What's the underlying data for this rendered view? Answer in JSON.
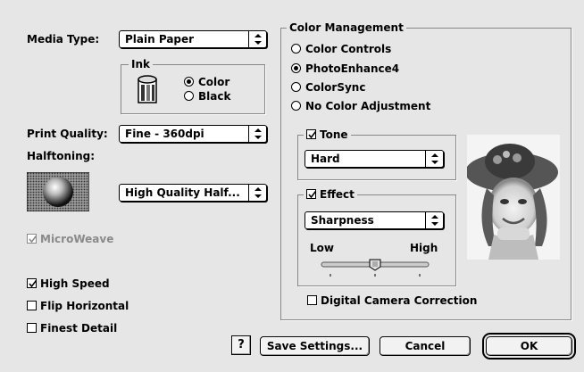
{
  "media_type": {
    "label": "Media Type:",
    "value": "Plain Paper"
  },
  "ink": {
    "title": "Ink",
    "options": [
      {
        "label": "Color",
        "selected": true
      },
      {
        "label": "Black",
        "selected": false
      }
    ]
  },
  "print_quality": {
    "label": "Print Quality:",
    "value": "Fine - 360dpi"
  },
  "halftoning": {
    "label": "Halftoning:",
    "value": "High Quality Half..."
  },
  "microweave": {
    "label": "MicroWeave",
    "checked": true,
    "enabled": false
  },
  "high_speed": {
    "label": "High Speed",
    "checked": true
  },
  "flip_horizontal": {
    "label": "Flip Horizontal",
    "checked": false
  },
  "finest_detail": {
    "label": "Finest Detail",
    "checked": false
  },
  "color_management": {
    "title": "Color Management",
    "options": [
      {
        "label": "Color Controls",
        "selected": false
      },
      {
        "label": "PhotoEnhance4",
        "selected": true
      },
      {
        "label": "ColorSync",
        "selected": false
      },
      {
        "label": "No Color Adjustment",
        "selected": false
      }
    ],
    "tone": {
      "label": "Tone",
      "checked": true,
      "value": "Hard"
    },
    "effect": {
      "label": "Effect",
      "checked": true,
      "value": "Sharpness",
      "low_label": "Low",
      "high_label": "High",
      "slider_level": 0.5
    },
    "digital_camera": {
      "label": "Digital Camera Correction",
      "checked": false
    }
  },
  "buttons": {
    "help": "?",
    "save_settings": "Save Settings...",
    "cancel": "Cancel",
    "ok": "OK"
  }
}
